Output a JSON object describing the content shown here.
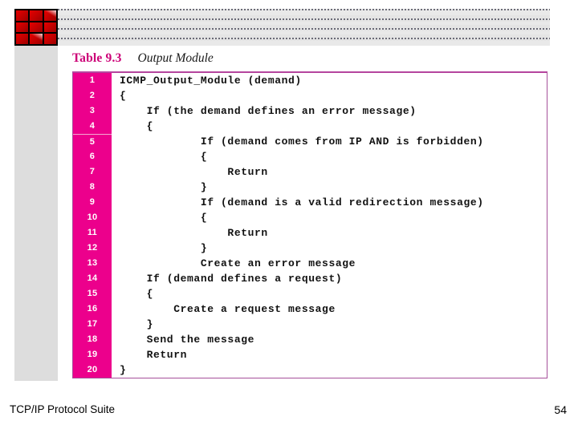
{
  "slide": {
    "logo": {
      "name": "nine-square-red-logo",
      "cells": 9,
      "cell_color": "#cc0000",
      "background_color": "#000000"
    },
    "header_band": {
      "pattern": "dotted-checker",
      "background_color": "#e9e9e9",
      "dot_color": "#4c4c5a"
    },
    "sidebar": {
      "background_color": "#dddddd"
    }
  },
  "caption": {
    "table_number": "Table 9.3",
    "table_title": "Output Module",
    "number_color": "#cc0077"
  },
  "code_table": {
    "border_color": "#a6509a",
    "line_number_background": "#ec008c",
    "line_number_color": "#ffffff",
    "rows": [
      {
        "n": "1",
        "text": "ICMP_Output_Module (demand)"
      },
      {
        "n": "2",
        "text": "{"
      },
      {
        "n": "3",
        "text": "    If (the demand defines an error message)"
      },
      {
        "n": "4",
        "text": "    {"
      },
      {
        "n": "5",
        "text": "            If (demand comes from IP AND is forbidden)"
      },
      {
        "n": "6",
        "text": "            {"
      },
      {
        "n": "7",
        "text": "                Return"
      },
      {
        "n": "8",
        "text": "            }"
      },
      {
        "n": "9",
        "text": "            If (demand is a valid redirection message)"
      },
      {
        "n": "10",
        "text": "            {"
      },
      {
        "n": "11",
        "text": "                Return"
      },
      {
        "n": "12",
        "text": "            }"
      },
      {
        "n": "13",
        "text": "            Create an error message"
      },
      {
        "n": "14",
        "text": "    If (demand defines a request)"
      },
      {
        "n": "15",
        "text": "    {"
      },
      {
        "n": "16",
        "text": "        Create a request message"
      },
      {
        "n": "17",
        "text": "    }"
      },
      {
        "n": "18",
        "text": "    Send the message"
      },
      {
        "n": "19",
        "text": "    Return"
      },
      {
        "n": "20",
        "text": "}"
      }
    ]
  },
  "footer": {
    "title": "TCP/IP Protocol Suite",
    "page_number": "54"
  }
}
